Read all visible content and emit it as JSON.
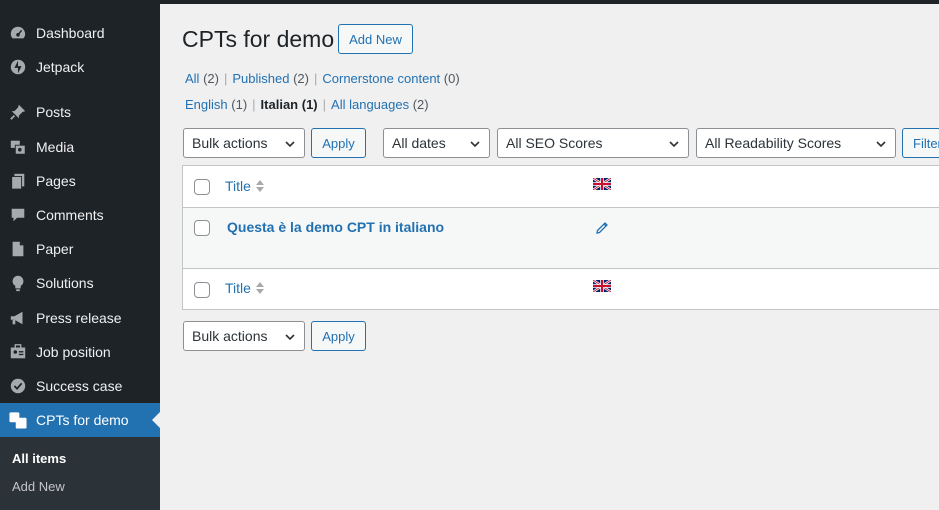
{
  "sidebar": {
    "items": [
      {
        "label": "Dashboard",
        "icon": "dashboard-icon"
      },
      {
        "label": "Jetpack",
        "icon": "jetpack-icon"
      },
      {
        "label": "Posts",
        "icon": "pin-icon"
      },
      {
        "label": "Media",
        "icon": "media-icon"
      },
      {
        "label": "Pages",
        "icon": "pages-icon"
      },
      {
        "label": "Comments",
        "icon": "comment-icon"
      },
      {
        "label": "Paper",
        "icon": "document-icon"
      },
      {
        "label": "Solutions",
        "icon": "lightbulb-icon"
      },
      {
        "label": "Press release",
        "icon": "megaphone-icon"
      },
      {
        "label": "Job position",
        "icon": "id-card-icon"
      },
      {
        "label": "Success case",
        "icon": "check-circle-icon"
      },
      {
        "label": "CPTs for demo",
        "icon": "translation-icon"
      }
    ],
    "submenu": {
      "all_items": "All items",
      "add_new": "Add New"
    }
  },
  "header": {
    "title": "CPTs for demo",
    "add_new": "Add New"
  },
  "status_filters": {
    "all": "All",
    "all_count": "(2)",
    "published": "Published",
    "published_count": "(2)",
    "cornerstone": "Cornerstone content",
    "cornerstone_count": "(0)",
    "sep": "|"
  },
  "language_filters": {
    "english": "English",
    "english_count": "(1)",
    "italian": "Italian",
    "italian_count": "(1)",
    "all_languages": "All languages",
    "all_languages_count": "(2)",
    "sep": "|"
  },
  "toolbar": {
    "bulk_actions": "Bulk actions",
    "apply": "Apply",
    "all_dates": "All dates",
    "seo_scores": "All SEO Scores",
    "readability_scores": "All Readability Scores",
    "filter": "Filter"
  },
  "table": {
    "column_title": "Title",
    "rows": [
      {
        "title": "Questa è la demo CPT in italiano"
      }
    ]
  },
  "colors": {
    "accent": "#2271b1",
    "sidebar_bg": "#1d2327",
    "submenu_bg": "#2c3338",
    "page_bg": "#f0f0f1"
  }
}
